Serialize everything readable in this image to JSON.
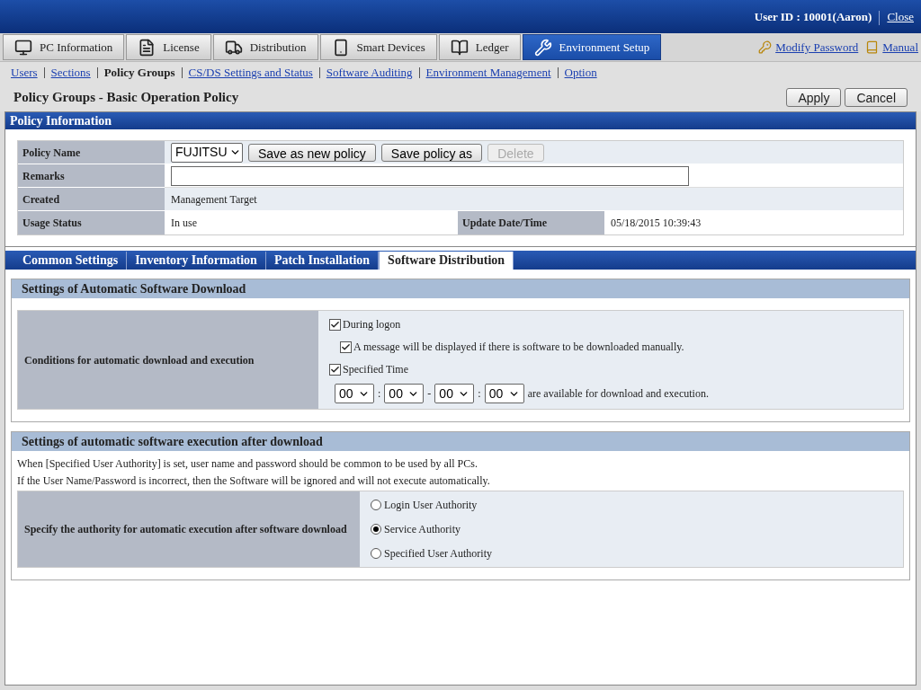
{
  "header": {
    "user": "User ID : 10001(Aaron)",
    "close": "Close"
  },
  "main_tabs": [
    {
      "label": "PC Information",
      "selected": false
    },
    {
      "label": "License",
      "selected": false
    },
    {
      "label": "Distribution",
      "selected": false
    },
    {
      "label": "Smart Devices",
      "selected": false
    },
    {
      "label": "Ledger",
      "selected": false
    },
    {
      "label": "Environment Setup",
      "selected": true
    }
  ],
  "top_links": [
    "Modify Password",
    "Manual"
  ],
  "sub_nav": [
    {
      "label": "Users",
      "selected": false
    },
    {
      "label": "Sections",
      "selected": false
    },
    {
      "label": "Policy Groups",
      "selected": true
    },
    {
      "label": "CS/DS Settings and Status",
      "selected": false
    },
    {
      "label": "Software Auditing",
      "selected": false
    },
    {
      "label": "Environment Management",
      "selected": false
    },
    {
      "label": "Option",
      "selected": false
    }
  ],
  "page_title": "Policy Groups - Basic Operation Policy",
  "page_buttons": [
    "Apply",
    "Cancel"
  ],
  "policy_info": {
    "title": "Policy Information",
    "policy_name_label": "Policy Name",
    "policy_select": "FUJITSU",
    "buttons": [
      {
        "label": "Save as new policy",
        "disabled": false
      },
      {
        "label": "Save policy as",
        "disabled": false
      },
      {
        "label": "Delete",
        "disabled": true
      }
    ],
    "remarks_label": "Remarks",
    "created_label": "Created",
    "created_value": "Management Target",
    "usage_label": "Usage Status",
    "usage_value": "In use",
    "update_label": "Update Date/Time",
    "update_value": "05/18/2015 10:39:43"
  },
  "settings_tabs": [
    {
      "label": "Common Settings",
      "selected": false
    },
    {
      "label": "Inventory Information",
      "selected": false
    },
    {
      "label": "Patch Installation",
      "selected": false
    },
    {
      "label": "Software Distribution",
      "selected": true
    }
  ],
  "download_section": {
    "title": "Settings of Automatic Software Download",
    "label": "Conditions for automatic download and execution",
    "during_logon": {
      "label": "During logon",
      "checked": true
    },
    "message": {
      "label": "A message will be displayed if there is software to be downloaded manually.",
      "checked": true
    },
    "specified_time": {
      "label": "Specified Time",
      "checked": true
    },
    "times": [
      "00",
      "00",
      "00",
      "00"
    ],
    "separators": [
      ":",
      "-",
      ":"
    ],
    "time_suffix": "are available for download and execution."
  },
  "execution_section": {
    "title": "Settings of automatic software execution after download",
    "notes": [
      "When [Specified User Authority] is set, user name and password should be common to be used by all PCs.",
      "If the User Name/Password is incorrect, then the Software will be ignored and will not execute automatically."
    ],
    "label": "Specify the authority for automatic execution after software download",
    "options": [
      {
        "label": "Login User Authority",
        "selected": false
      },
      {
        "label": "Service Authority",
        "selected": true
      },
      {
        "label": "Specified User Authority",
        "selected": false
      }
    ]
  }
}
